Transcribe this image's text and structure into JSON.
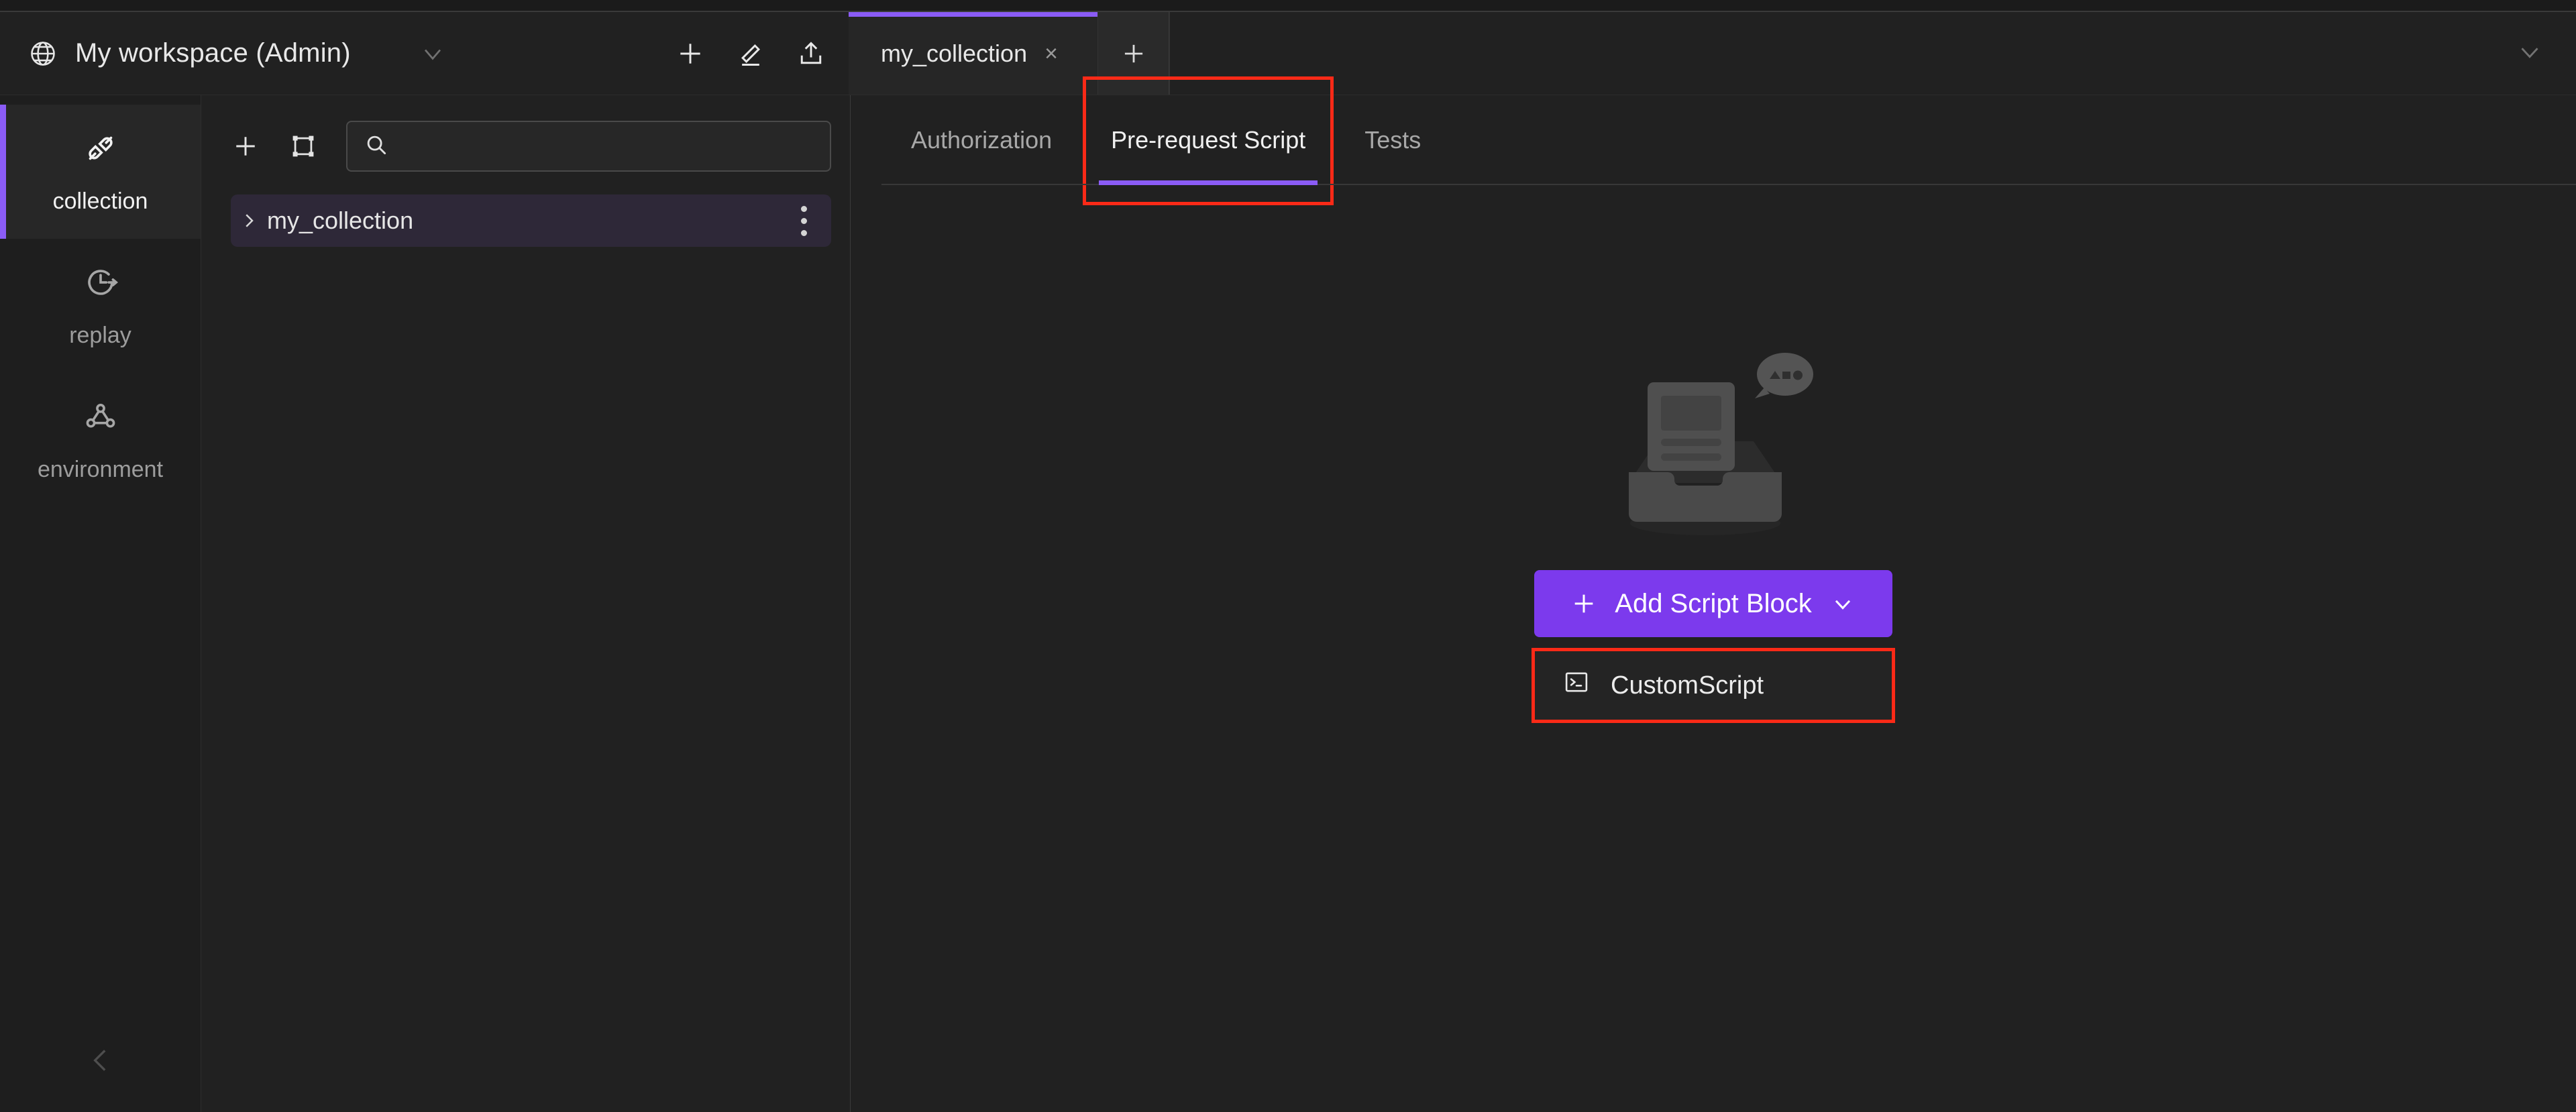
{
  "workspace": {
    "globe_icon": "globe-icon",
    "title": "My workspace (Admin)",
    "caret_icon": "chevron-down-icon",
    "actions": [
      {
        "name": "add-workspace-button",
        "icon": "plus-icon"
      },
      {
        "name": "edit-workspace-button",
        "icon": "pencil-icon"
      },
      {
        "name": "export-workspace-button",
        "icon": "upload-icon"
      }
    ]
  },
  "tabbar": {
    "tabs": [
      {
        "label": "my_collection",
        "close": "×",
        "active": true
      }
    ],
    "new_tab_icon": "plus-icon",
    "overflow_icon": "chevron-down-icon"
  },
  "rail": {
    "items": [
      {
        "label": "collection",
        "icon": "plug-connector-icon",
        "active": true
      },
      {
        "label": "replay",
        "icon": "history-clock-icon",
        "active": false
      },
      {
        "label": "environment",
        "icon": "node-graph-icon",
        "active": false
      }
    ],
    "collapse_icon": "chevron-left-icon"
  },
  "collection_panel": {
    "toolbar": {
      "add_icon": "plus-icon",
      "frame_icon": "select-frame-icon"
    },
    "search": {
      "icon": "search-icon",
      "value": "",
      "placeholder": ""
    },
    "tree": [
      {
        "name": "my_collection",
        "caret": "chevron-right-icon",
        "selected": true,
        "menu_icon": "kebab-menu-icon"
      }
    ]
  },
  "main": {
    "tabs": [
      {
        "label": "Authorization",
        "active": false,
        "annotated": false
      },
      {
        "label": "Pre-request Script",
        "active": true,
        "annotated": true
      },
      {
        "label": "Tests",
        "active": false,
        "annotated": false
      }
    ],
    "empty_state": {
      "illustration": "document-in-tray-illustration"
    },
    "add_button": {
      "label": "Add Script Block",
      "plus_icon": "plus-icon",
      "caret_icon": "chevron-down-icon"
    },
    "dropdown": {
      "items": [
        {
          "label": "CustomScript",
          "icon": "terminal-icon",
          "annotated": true
        }
      ]
    }
  },
  "colors": {
    "accent_purple": "#8b5cf6",
    "button_purple": "#7c3aed",
    "annotation_red": "#fb2a17",
    "bg": "#212121",
    "selected_row": "#2e2838"
  }
}
